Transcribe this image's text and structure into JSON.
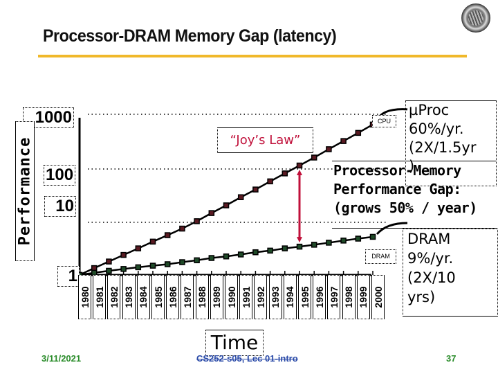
{
  "slide": {
    "title": "Processor-DRAM Memory Gap (latency)",
    "footer": {
      "date": "3/11/2021",
      "course": "CS252-s05, Lec 01-intro",
      "page": "37"
    },
    "colors": {
      "title_rule": "#f0b82a",
      "footer_green": "#2a8c2a",
      "footer_blue": "#2a4aa8",
      "annotation_red": "#c0103a",
      "cpu_marker": "#5a1a22",
      "dram_marker": "#1f4a28"
    }
  },
  "chart_data": {
    "type": "line",
    "title": "Processor-DRAM Memory Gap (latency)",
    "xlabel": "Time",
    "ylabel": "Performance",
    "yscale": "log",
    "ylim": [
      1,
      1000
    ],
    "yticks": [
      "1",
      "10",
      "100",
      "1000"
    ],
    "ytick_values": [
      1,
      10,
      100,
      1000
    ],
    "grid": "dotted horizontal at 10, 100, 1000",
    "x": [
      "1980",
      "1981",
      "1982",
      "1983",
      "1984",
      "1985",
      "1986",
      "1987",
      "1988",
      "1989",
      "1990",
      "1991",
      "1992",
      "1993",
      "1994",
      "1995",
      "1996",
      "1997",
      "1998",
      "1999",
      "2000"
    ],
    "series": [
      {
        "name": "CPU",
        "label": "CPU",
        "values": [
          1,
          1.35,
          1.8,
          2.4,
          3.2,
          4.3,
          5.7,
          7.6,
          10.5,
          15,
          21,
          30,
          42,
          60,
          85,
          120,
          170,
          245,
          350,
          500,
          720
        ]
      },
      {
        "name": "DRAM",
        "label": "DRAM",
        "values": [
          1,
          1.1,
          1.2,
          1.3,
          1.4,
          1.5,
          1.6,
          1.75,
          1.9,
          2.1,
          2.25,
          2.45,
          2.7,
          2.9,
          3.2,
          3.45,
          3.75,
          4.1,
          4.5,
          4.9,
          5.3
        ]
      }
    ],
    "annotations": {
      "joys_law": "“Joy’s Law”",
      "proc": "µProc\n60%/yr.\n(2X/1.5yr\n)",
      "gap": "Processor-Memory\nPerformance Gap:\n(grows 50% / year)",
      "dram": "DRAM\n9%/yr.\n(2X/10\nyrs)",
      "gap_arrow_year": "1995"
    }
  }
}
